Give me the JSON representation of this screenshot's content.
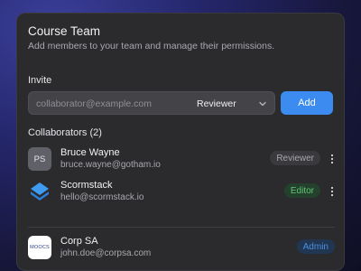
{
  "dialog": {
    "title": "Course Team",
    "subtitle": "Add members to your team and manage their permissions."
  },
  "invite": {
    "label": "Invite",
    "email_placeholder": "collaborator@example.com",
    "role_value": "Reviewer",
    "add_label": "Add"
  },
  "collaborators": {
    "label": "Collaborators (2)",
    "items": [
      {
        "avatar": "PS",
        "name": "Bruce Wayne",
        "email": "bruce.wayne@gotham.io",
        "role": "Reviewer"
      },
      {
        "avatar": "scormstack-logo",
        "name": "Scormstack",
        "email": "hello@scormstack.io",
        "role": "Editor"
      }
    ]
  },
  "owner": {
    "avatar_text": "MOOCS",
    "name": "Corp SA",
    "email": "john.doe@corpsa.com",
    "role": "Admin"
  },
  "colors": {
    "accent": "#3b8bf0",
    "editor": "#62c476",
    "admin": "#4e8fe0",
    "card": "#2b2b2e"
  }
}
